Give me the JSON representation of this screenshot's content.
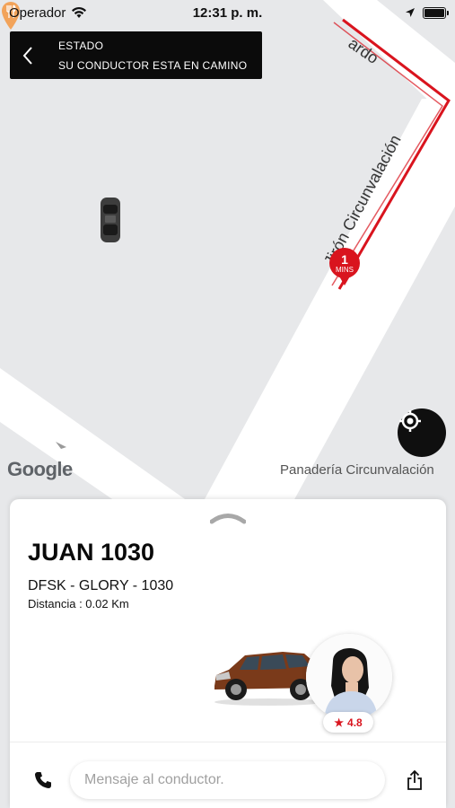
{
  "status_bar": {
    "carrier": "Operador",
    "time": "12:31 p. m."
  },
  "banner": {
    "title": "ESTADO",
    "message": "SU CONDUCTOR ESTA EN CAMINO"
  },
  "map": {
    "street_name": "Jirón Circunvalación",
    "street_name_partial": "ardo",
    "eta": {
      "value": "1",
      "unit": "MINS"
    },
    "poi_name": "Panadería Circunvalación",
    "google_logo": "Google",
    "route_color": "#d9141e"
  },
  "driver": {
    "name": "JUAN 1030",
    "vehicle": "DFSK - GLORY - 1030",
    "distance": "Distancia : 0.02 Km",
    "rating": "4.8"
  },
  "message": {
    "placeholder": "Mensaje al conductor."
  },
  "icons": {
    "back": "chevron-left-icon",
    "location": "my-location-icon",
    "phone": "phone-icon",
    "share": "share-icon",
    "star": "star-icon"
  },
  "colors": {
    "accent": "#d9141e",
    "banner_bg": "#0b0b0b",
    "map_bg": "#e7e8ea"
  }
}
